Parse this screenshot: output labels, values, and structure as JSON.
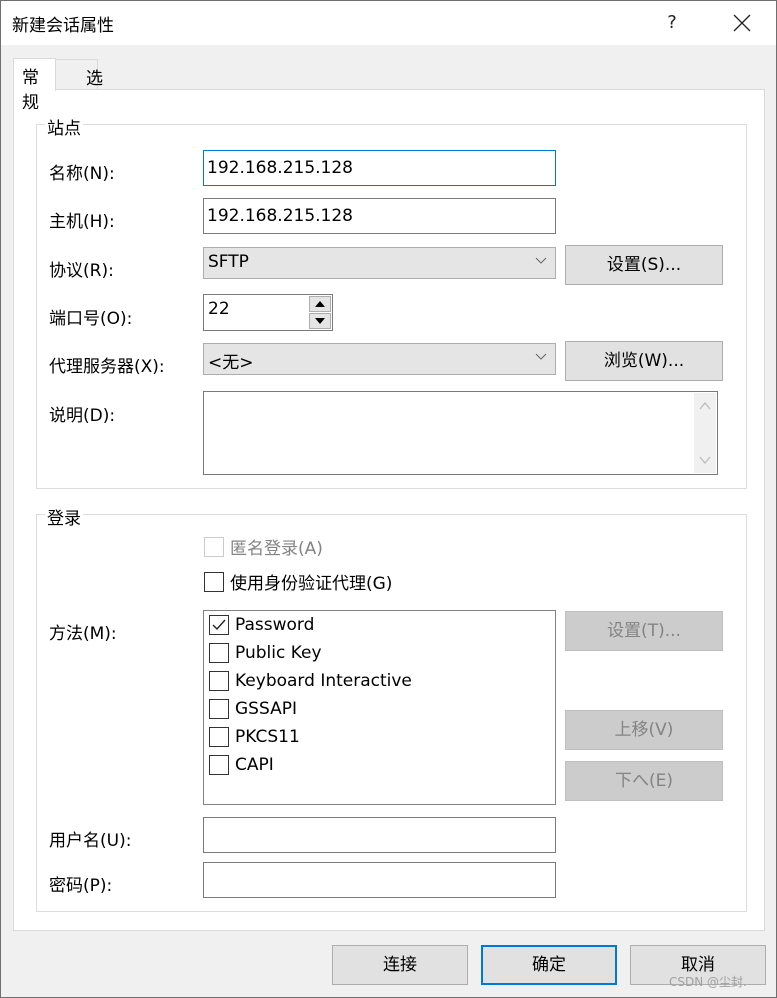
{
  "window": {
    "title": "新建会话属性",
    "help_label": "?",
    "close_icon": "close-icon"
  },
  "tabs": [
    {
      "label": "常规",
      "active": true
    },
    {
      "label": "选项",
      "active": false
    }
  ],
  "site": {
    "legend": "站点",
    "name_label": "名称(N):",
    "name_value": "192.168.215.128",
    "host_label": "主机(H):",
    "host_value": "192.168.215.128",
    "protocol_label": "协议(R):",
    "protocol_value": "SFTP",
    "protocol_settings_button": "设置(S)...",
    "port_label": "端口号(O):",
    "port_value": "22",
    "proxy_label": "代理服务器(X):",
    "proxy_value": "<无>",
    "browse_button": "浏览(W)...",
    "description_label": "说明(D):",
    "description_value": ""
  },
  "login": {
    "legend": "登录",
    "anonymous_label": "匿名登录(A)",
    "anonymous_checked": false,
    "anonymous_disabled": true,
    "agent_label": "使用身份验证代理(G)",
    "agent_checked": false,
    "method_label": "方法(M):",
    "methods": [
      {
        "label": "Password",
        "checked": true
      },
      {
        "label": "Public Key",
        "checked": false
      },
      {
        "label": "Keyboard Interactive",
        "checked": false
      },
      {
        "label": "GSSAPI",
        "checked": false
      },
      {
        "label": "PKCS11",
        "checked": false
      },
      {
        "label": "CAPI",
        "checked": false
      }
    ],
    "method_settings_button": "设置(T)...",
    "move_up_button": "上移(V)",
    "move_down_button": "下へ(E)",
    "username_label": "用户名(U):",
    "username_value": "",
    "password_label": "密码(P):",
    "password_value": ""
  },
  "footer": {
    "connect_button": "连接",
    "ok_button": "确定",
    "cancel_button": "取消"
  },
  "watermark": "CSDN @尘封."
}
